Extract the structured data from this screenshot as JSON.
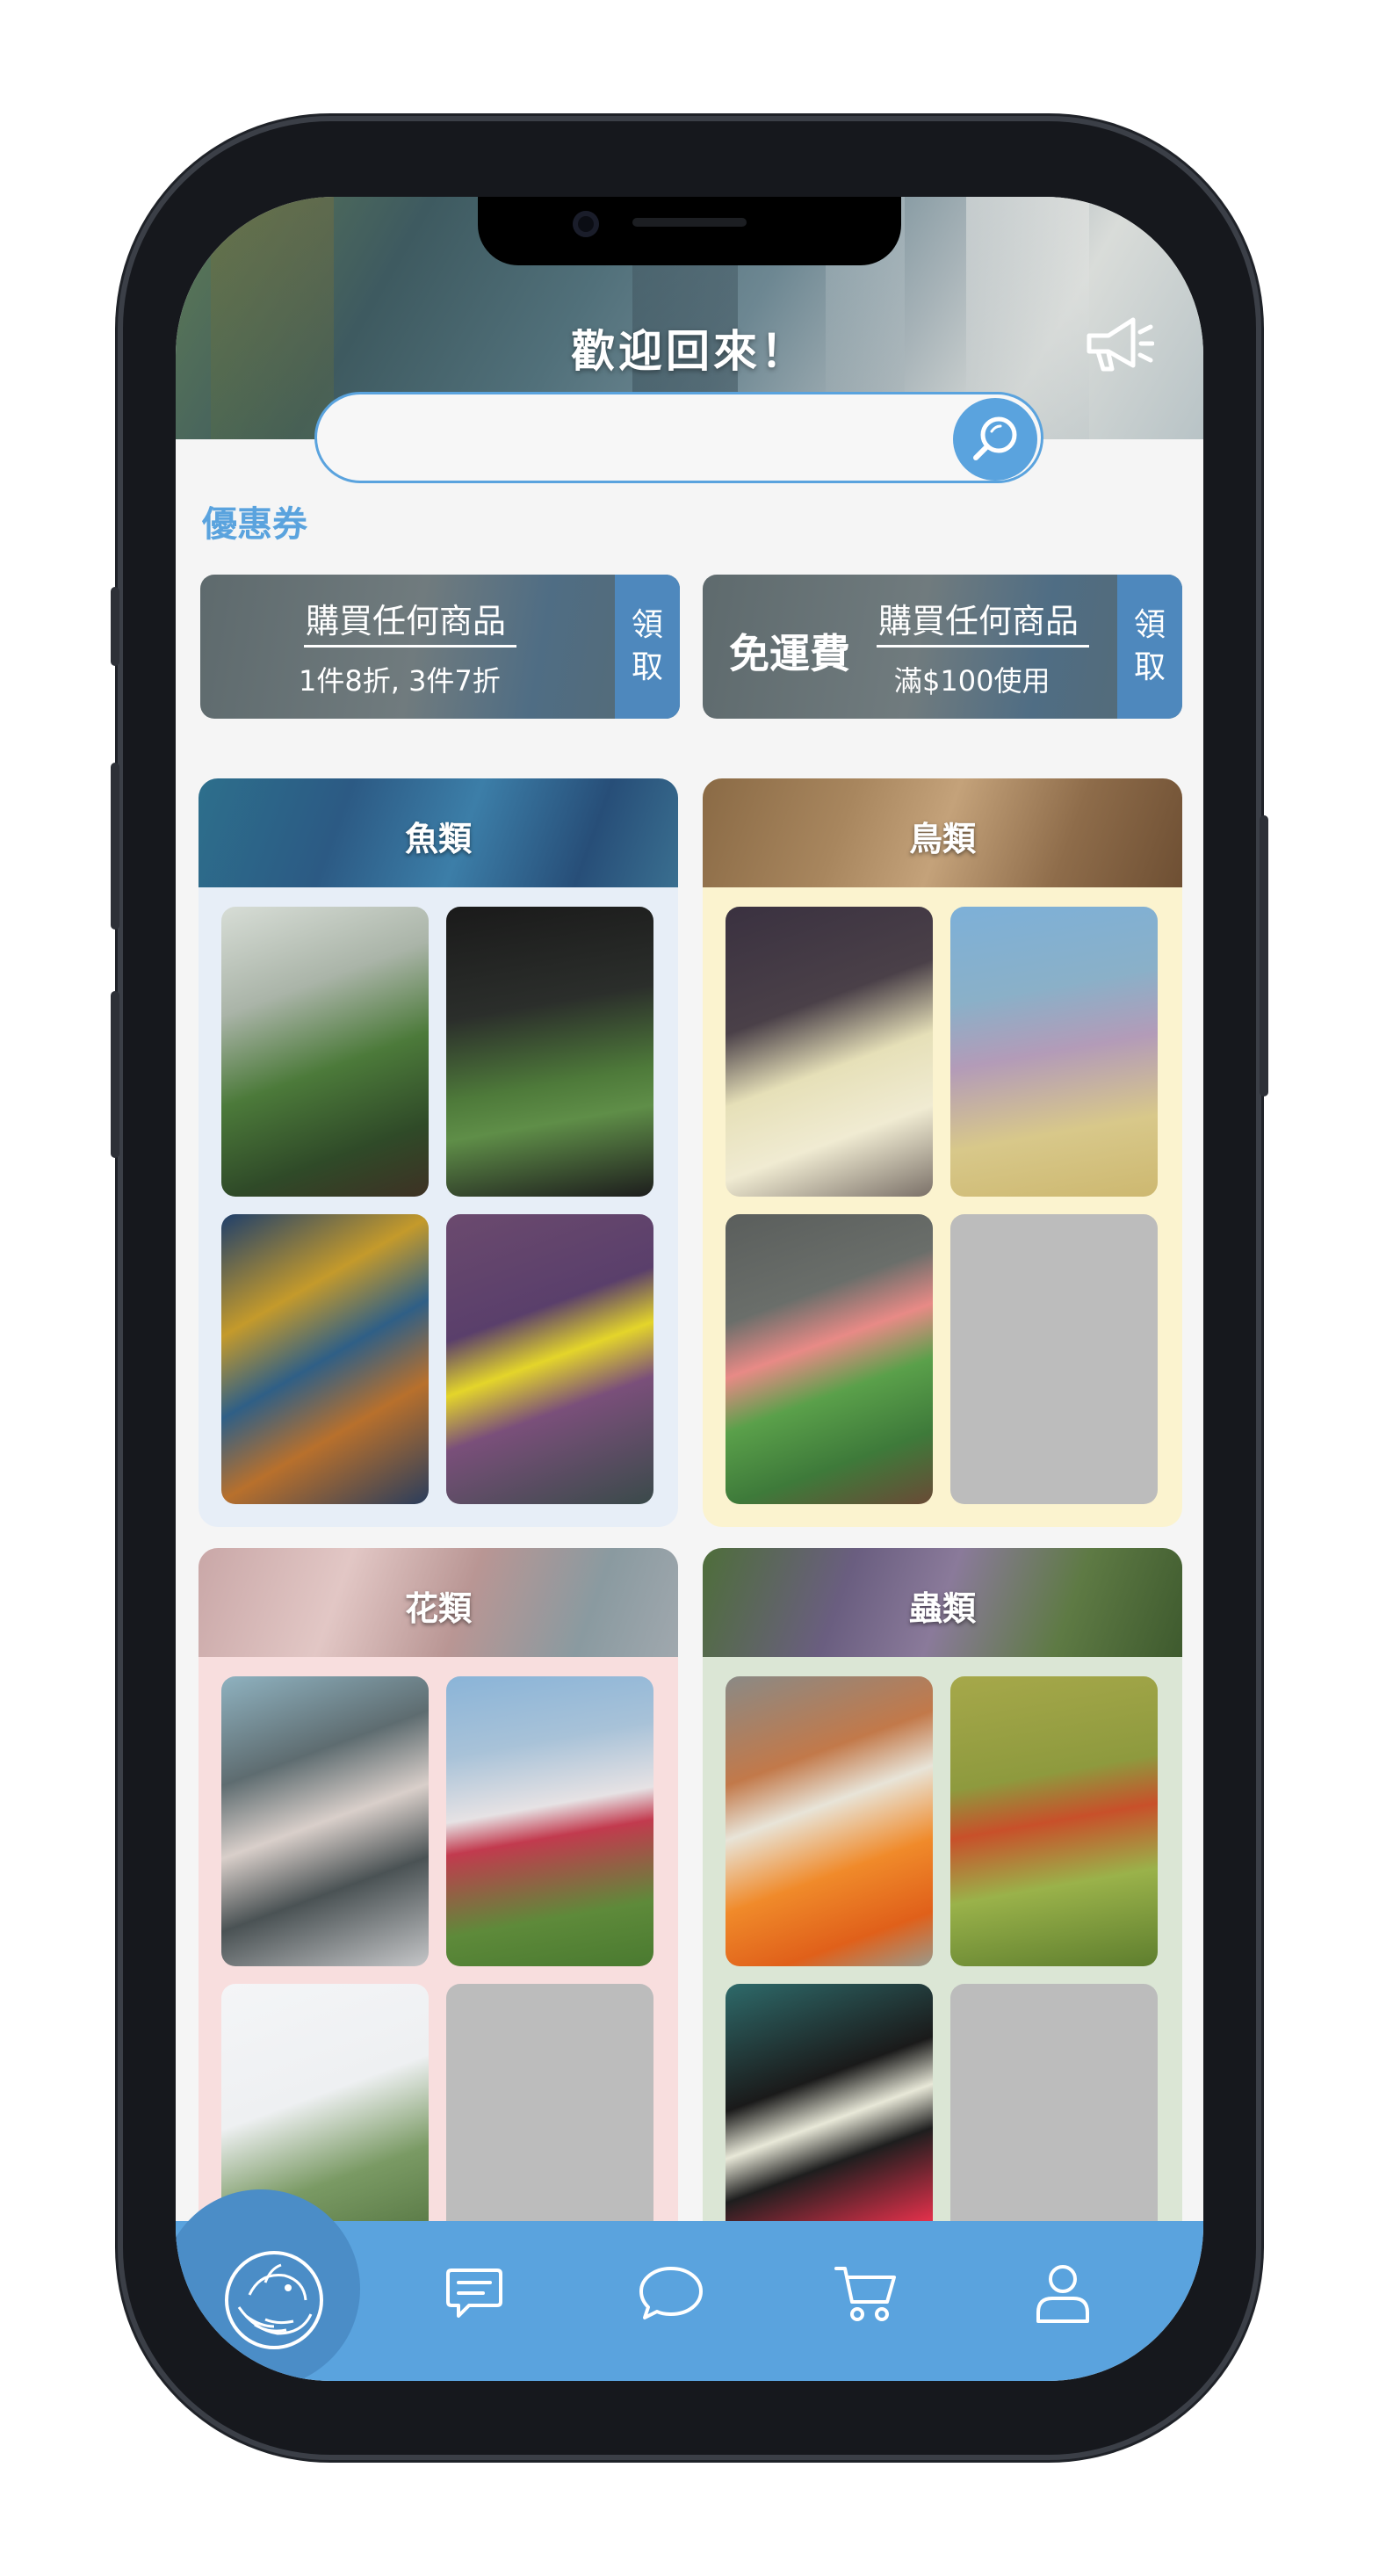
{
  "header": {
    "title": "歡迎回來！",
    "icon": "megaphone-icon"
  },
  "search": {
    "value": "",
    "placeholder": "",
    "icon": "search-icon"
  },
  "coupons": {
    "section_label": "優惠券",
    "items": [
      {
        "headline": "",
        "title": "購買任何商品",
        "detail": "1件8折, 3件7折",
        "claim": "領\n取"
      },
      {
        "headline": "免運費",
        "title": "購買任何商品",
        "detail": "滿$100使用",
        "claim": "領\n取"
      }
    ]
  },
  "categories": [
    {
      "name": "魚類",
      "tiles": [
        "betta-fish-aquarium",
        "planted-aquarium-tank",
        "coral-reef",
        "yellow-tang-fish"
      ],
      "bg": "#e7eef7"
    },
    {
      "name": "鳥類",
      "tiles": [
        "cockatiel",
        "lilac-breasted-roller",
        "lovebird",
        "empty"
      ],
      "bg": "#fbf3cf"
    },
    {
      "name": "花類",
      "tiles": [
        "cherry-blossom-tree",
        "tulips",
        "eucalyptus-branch",
        "empty"
      ],
      "bg": "#f8dede"
    },
    {
      "name": "蟲類",
      "tiles": [
        "painted-lady-butterfly",
        "ladybug",
        "swallowtail-butterfly",
        "empty"
      ],
      "bg": "#dbe6d5"
    }
  ],
  "nav": {
    "items": [
      "home-logo-icon",
      "chat-list-icon",
      "message-bubble-icon",
      "shopping-cart-icon",
      "user-profile-icon"
    ]
  },
  "colors": {
    "accent": "#5aa3de",
    "accent_dark": "#4b8dc7",
    "claim_button": "#4e88bd"
  }
}
